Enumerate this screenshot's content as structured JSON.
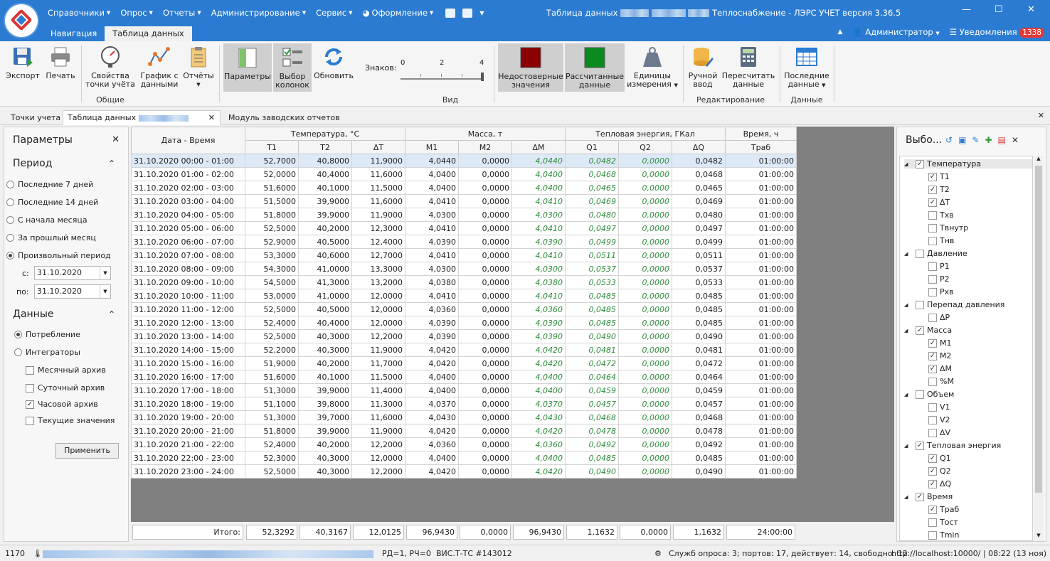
{
  "app": {
    "title_prefix": "Таблица данных",
    "title_suffix": "Теплоснабжение - ЛЭРС УЧЕТ версия 3.36.5"
  },
  "menu": [
    "Справочники",
    "Опрос",
    "Отчеты",
    "Администрирование",
    "Сервис",
    "Оформление"
  ],
  "ribbon_tabs": [
    "Навигация",
    "Таблица данных"
  ],
  "user": {
    "name": "Администратор",
    "notifications_label": "Уведомления",
    "notifications_count": "1338"
  },
  "ribbon": {
    "export": "Экспорт",
    "print": "Печать",
    "props1": "Свойства",
    "props2": "точки учёта",
    "graph1": "График с",
    "graph2": "данными",
    "reports": "Отчёты",
    "general": "Общие",
    "params": "Параметры",
    "cols1": "Выбор",
    "cols2": "колонок",
    "refresh": "Обновить",
    "digits": "Знаков:",
    "t0": "0",
    "t2": "2",
    "t4": "4",
    "view": "Вид",
    "unrel1": "Недостоверные",
    "unrel2": "значения",
    "calc1": "Рассчитанные",
    "calc2": "данные",
    "units1": "Единицы",
    "units2": "измерения",
    "manual1": "Ручной",
    "manual2": "ввод",
    "recalc1": "Пересчитать",
    "recalc2": "данные",
    "editing": "Редактирование",
    "last1": "Последние",
    "last2": "данные",
    "data": "Данные"
  },
  "doc_tabs": {
    "t1": "Точки учета",
    "t2": "Таблица данных",
    "t3": "Модуль заводских отчетов"
  },
  "left": {
    "title": "Параметры",
    "period": "Период",
    "r1": "Последние 7 дней",
    "r2": "Последние 14 дней",
    "r3": "С начала месяца",
    "r4": "За прошлый месяц",
    "r5": "Произвольный период",
    "from_label": "с:",
    "from": "31.10.2020",
    "to_label": "по:",
    "to": "31.10.2020",
    "data": "Данные",
    "consumption": "Потребление",
    "integrators": "Интеграторы",
    "c1": "Месячный архив",
    "c2": "Суточный архив",
    "c3": "Часовой архив",
    "c4": "Текущие значения",
    "apply": "Применить"
  },
  "grid": {
    "h_dt": "Дата - Время",
    "g_temp": "Температура, °С",
    "g_mass": "Масса, т",
    "g_heat": "Тепловая энергия, ГКал",
    "g_time": "Время, ч",
    "cols": [
      "T1",
      "T2",
      "ΔT",
      "M1",
      "M2",
      "ΔM",
      "Q1",
      "Q2",
      "ΔQ",
      "Траб"
    ],
    "rows": [
      [
        "31.10.2020 00:00 - 01:00",
        "52,7000",
        "40,8000",
        "11,9000",
        "4,0440",
        "0,0000",
        "4,0440",
        "0,0482",
        "0,0000",
        "0,0482",
        "01:00:00"
      ],
      [
        "31.10.2020 01:00 - 02:00",
        "52,0000",
        "40,4000",
        "11,6000",
        "4,0400",
        "0,0000",
        "4,0400",
        "0,0468",
        "0,0000",
        "0,0468",
        "01:00:00"
      ],
      [
        "31.10.2020 02:00 - 03:00",
        "51,6000",
        "40,1000",
        "11,5000",
        "4,0400",
        "0,0000",
        "4,0400",
        "0,0465",
        "0,0000",
        "0,0465",
        "01:00:00"
      ],
      [
        "31.10.2020 03:00 - 04:00",
        "51,5000",
        "39,9000",
        "11,6000",
        "4,0410",
        "0,0000",
        "4,0410",
        "0,0469",
        "0,0000",
        "0,0469",
        "01:00:00"
      ],
      [
        "31.10.2020 04:00 - 05:00",
        "51,8000",
        "39,9000",
        "11,9000",
        "4,0300",
        "0,0000",
        "4,0300",
        "0,0480",
        "0,0000",
        "0,0480",
        "01:00:00"
      ],
      [
        "31.10.2020 05:00 - 06:00",
        "52,5000",
        "40,2000",
        "12,3000",
        "4,0410",
        "0,0000",
        "4,0410",
        "0,0497",
        "0,0000",
        "0,0497",
        "01:00:00"
      ],
      [
        "31.10.2020 06:00 - 07:00",
        "52,9000",
        "40,5000",
        "12,4000",
        "4,0390",
        "0,0000",
        "4,0390",
        "0,0499",
        "0,0000",
        "0,0499",
        "01:00:00"
      ],
      [
        "31.10.2020 07:00 - 08:00",
        "53,3000",
        "40,6000",
        "12,7000",
        "4,0410",
        "0,0000",
        "4,0410",
        "0,0511",
        "0,0000",
        "0,0511",
        "01:00:00"
      ],
      [
        "31.10.2020 08:00 - 09:00",
        "54,3000",
        "41,0000",
        "13,3000",
        "4,0300",
        "0,0000",
        "4,0300",
        "0,0537",
        "0,0000",
        "0,0537",
        "01:00:00"
      ],
      [
        "31.10.2020 09:00 - 10:00",
        "54,5000",
        "41,3000",
        "13,2000",
        "4,0380",
        "0,0000",
        "4,0380",
        "0,0533",
        "0,0000",
        "0,0533",
        "01:00:00"
      ],
      [
        "31.10.2020 10:00 - 11:00",
        "53,0000",
        "41,0000",
        "12,0000",
        "4,0410",
        "0,0000",
        "4,0410",
        "0,0485",
        "0,0000",
        "0,0485",
        "01:00:00"
      ],
      [
        "31.10.2020 11:00 - 12:00",
        "52,5000",
        "40,5000",
        "12,0000",
        "4,0360",
        "0,0000",
        "4,0360",
        "0,0485",
        "0,0000",
        "0,0485",
        "01:00:00"
      ],
      [
        "31.10.2020 12:00 - 13:00",
        "52,4000",
        "40,4000",
        "12,0000",
        "4,0390",
        "0,0000",
        "4,0390",
        "0,0485",
        "0,0000",
        "0,0485",
        "01:00:00"
      ],
      [
        "31.10.2020 13:00 - 14:00",
        "52,5000",
        "40,3000",
        "12,2000",
        "4,0390",
        "0,0000",
        "4,0390",
        "0,0490",
        "0,0000",
        "0,0490",
        "01:00:00"
      ],
      [
        "31.10.2020 14:00 - 15:00",
        "52,2000",
        "40,3000",
        "11,9000",
        "4,0420",
        "0,0000",
        "4,0420",
        "0,0481",
        "0,0000",
        "0,0481",
        "01:00:00"
      ],
      [
        "31.10.2020 15:00 - 16:00",
        "51,9000",
        "40,2000",
        "11,7000",
        "4,0420",
        "0,0000",
        "4,0420",
        "0,0472",
        "0,0000",
        "0,0472",
        "01:00:00"
      ],
      [
        "31.10.2020 16:00 - 17:00",
        "51,6000",
        "40,1000",
        "11,5000",
        "4,0400",
        "0,0000",
        "4,0400",
        "0,0464",
        "0,0000",
        "0,0464",
        "01:00:00"
      ],
      [
        "31.10.2020 17:00 - 18:00",
        "51,3000",
        "39,9000",
        "11,4000",
        "4,0400",
        "0,0000",
        "4,0400",
        "0,0459",
        "0,0000",
        "0,0459",
        "01:00:00"
      ],
      [
        "31.10.2020 18:00 - 19:00",
        "51,1000",
        "39,8000",
        "11,3000",
        "4,0370",
        "0,0000",
        "4,0370",
        "0,0457",
        "0,0000",
        "0,0457",
        "01:00:00"
      ],
      [
        "31.10.2020 19:00 - 20:00",
        "51,3000",
        "39,7000",
        "11,6000",
        "4,0430",
        "0,0000",
        "4,0430",
        "0,0468",
        "0,0000",
        "0,0468",
        "01:00:00"
      ],
      [
        "31.10.2020 20:00 - 21:00",
        "51,8000",
        "39,9000",
        "11,9000",
        "4,0420",
        "0,0000",
        "4,0420",
        "0,0478",
        "0,0000",
        "0,0478",
        "01:00:00"
      ],
      [
        "31.10.2020 21:00 - 22:00",
        "52,4000",
        "40,2000",
        "12,2000",
        "4,0360",
        "0,0000",
        "4,0360",
        "0,0492",
        "0,0000",
        "0,0492",
        "01:00:00"
      ],
      [
        "31.10.2020 22:00 - 23:00",
        "52,3000",
        "40,3000",
        "12,0000",
        "4,0400",
        "0,0000",
        "4,0400",
        "0,0485",
        "0,0000",
        "0,0485",
        "01:00:00"
      ],
      [
        "31.10.2020 23:00 - 24:00",
        "52,5000",
        "40,3000",
        "12,2000",
        "4,0420",
        "0,0000",
        "4,0420",
        "0,0490",
        "0,0000",
        "0,0490",
        "01:00:00"
      ]
    ],
    "total_label": "Итого:",
    "totals": [
      "52,3292",
      "40,3167",
      "12,0125",
      "96,9430",
      "0,0000",
      "96,9430",
      "1,1632",
      "0,0000",
      "1,1632",
      "24:00:00"
    ]
  },
  "right": {
    "title": "Выбо...",
    "tree": [
      {
        "label": "Температура",
        "level": 0,
        "checked": true
      },
      {
        "label": "T1",
        "level": 1,
        "checked": true
      },
      {
        "label": "T2",
        "level": 1,
        "checked": true
      },
      {
        "label": "ΔT",
        "level": 1,
        "checked": true
      },
      {
        "label": "Tхв",
        "level": 1,
        "checked": false
      },
      {
        "label": "Tвнутр",
        "level": 1,
        "checked": false
      },
      {
        "label": "Tнв",
        "level": 1,
        "checked": false
      },
      {
        "label": "Давление",
        "level": 0,
        "checked": false
      },
      {
        "label": "P1",
        "level": 1,
        "checked": false
      },
      {
        "label": "P2",
        "level": 1,
        "checked": false
      },
      {
        "label": "Pхв",
        "level": 1,
        "checked": false
      },
      {
        "label": "Перепад давления",
        "level": 0,
        "checked": false
      },
      {
        "label": "ΔP",
        "level": 1,
        "checked": false
      },
      {
        "label": "Масса",
        "level": 0,
        "checked": true
      },
      {
        "label": "M1",
        "level": 1,
        "checked": true
      },
      {
        "label": "M2",
        "level": 1,
        "checked": true
      },
      {
        "label": "ΔM",
        "level": 1,
        "checked": true
      },
      {
        "label": "%M",
        "level": 1,
        "checked": false
      },
      {
        "label": "Объем",
        "level": 0,
        "checked": false
      },
      {
        "label": "V1",
        "level": 1,
        "checked": false
      },
      {
        "label": "V2",
        "level": 1,
        "checked": false
      },
      {
        "label": "ΔV",
        "level": 1,
        "checked": false
      },
      {
        "label": "Тепловая энергия",
        "level": 0,
        "checked": true
      },
      {
        "label": "Q1",
        "level": 1,
        "checked": true
      },
      {
        "label": "Q2",
        "level": 1,
        "checked": true
      },
      {
        "label": "ΔQ",
        "level": 1,
        "checked": true
      },
      {
        "label": "Время",
        "level": 0,
        "checked": true
      },
      {
        "label": "Траб",
        "level": 1,
        "checked": true
      },
      {
        "label": "Тост",
        "level": 1,
        "checked": false
      },
      {
        "label": "Tmin",
        "level": 1,
        "checked": false
      }
    ]
  },
  "status": {
    "id": "1170",
    "rd": "РД=1, РЧ=0",
    "device": "ВИС.Т-ТС #143012",
    "services": "Служб опроса: 3; портов: 17, действует: 14, свободно: 12",
    "url": "http://localhost:10000/ | 08:22 (13 ноя)"
  },
  "colors": {
    "accent": "#2a7bd1",
    "calc_text": "#2e8b3a",
    "unreliable": "#8b0000",
    "calculated": "#0a8a1e"
  }
}
